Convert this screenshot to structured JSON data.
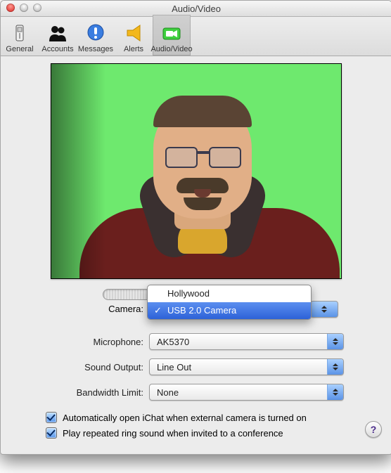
{
  "window": {
    "title": "Audio/Video"
  },
  "toolbar": {
    "items": [
      {
        "label": "General"
      },
      {
        "label": "Accounts"
      },
      {
        "label": "Messages"
      },
      {
        "label": "Alerts"
      },
      {
        "label": "Audio/Video"
      }
    ]
  },
  "form": {
    "camera": {
      "label": "Camera:",
      "options": [
        "Hollywood",
        "USB 2.0 Camera"
      ],
      "selected": "USB 2.0 Camera"
    },
    "microphone": {
      "label": "Microphone:",
      "value": "AK5370"
    },
    "sound_output": {
      "label": "Sound Output:",
      "value": "Line Out"
    },
    "bandwidth": {
      "label": "Bandwidth Limit:",
      "value": "None"
    }
  },
  "checkboxes": {
    "auto_open": "Automatically open iChat when external camera is turned on",
    "repeated_ring": "Play repeated ring sound when invited to a conference"
  },
  "help": "?"
}
